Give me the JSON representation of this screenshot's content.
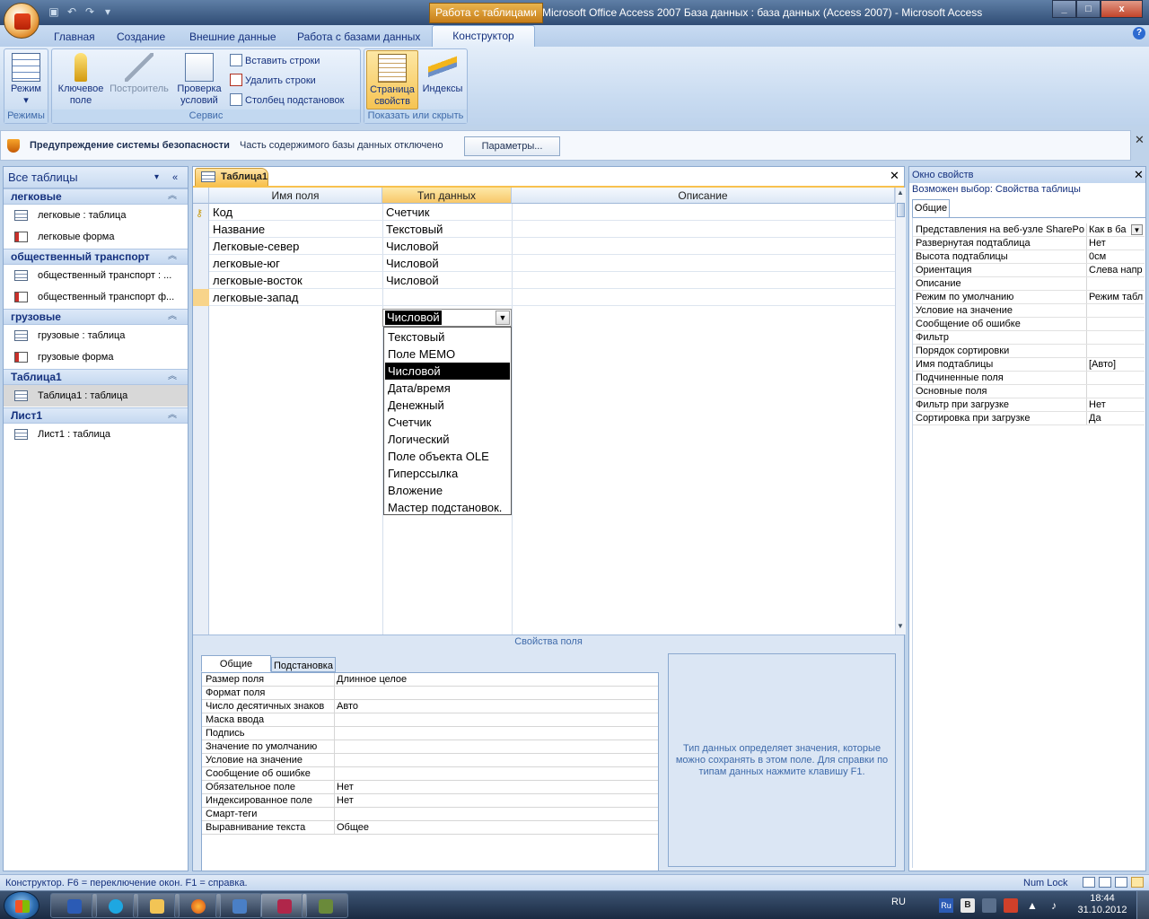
{
  "window": {
    "context_title": "Работа с таблицами",
    "title": "Microsoft Office Access 2007 База данных : база данных (Access 2007) - Microsoft Access",
    "controls": [
      "_",
      "□",
      "x"
    ]
  },
  "qat": {
    "icons": [
      "save-icon",
      "undo-icon",
      "redo-icon",
      "customize-icon"
    ]
  },
  "ribbon": {
    "tabs": [
      "Главная",
      "Создание",
      "Внешние данные",
      "Работа с базами данных",
      "Конструктор"
    ],
    "active_tab": "Конструктор",
    "groups": {
      "views": {
        "label": "Режимы",
        "mode_line1": "Режим",
        "mode_line2": "▾"
      },
      "tools": {
        "label": "Сервис",
        "key_line1": "Ключевое",
        "key_line2": "поле",
        "builder": "Построитель",
        "validate_line1": "Проверка",
        "validate_line2": "условий",
        "insert_rows": "Вставить строки",
        "delete_rows": "Удалить строки",
        "lookup_column": "Столбец  подстановок"
      },
      "show_hide": {
        "label": "Показать или скрыть",
        "props_line1": "Страница",
        "props_line2": "свойств",
        "indexes": "Индексы"
      }
    }
  },
  "security_bar": {
    "title": "Предупреждение системы безопасности",
    "message": "Часть содержимого базы данных отключено",
    "button": "Параметры..."
  },
  "nav": {
    "header": "Все таблицы",
    "groups": [
      {
        "label": "легковые",
        "items": [
          "легковые : таблица",
          "легковые форма"
        ]
      },
      {
        "label": "общественный транспорт",
        "items": [
          "общественный транспорт : ...",
          "общественный транспорт ф..."
        ]
      },
      {
        "label": "грузовые",
        "items": [
          "грузовые : таблица",
          "грузовые форма"
        ]
      },
      {
        "label": "Таблица1",
        "items": [
          "Таблица1 : таблица"
        ]
      },
      {
        "label": "Лист1",
        "items": [
          "Лист1 : таблица"
        ]
      }
    ]
  },
  "document": {
    "tab": "Таблица1",
    "columns": [
      "Имя поля",
      "Тип данных",
      "Описание"
    ],
    "rows": [
      {
        "name": "Код",
        "type": "Счетчик",
        "desc": "",
        "key": true
      },
      {
        "name": "Название",
        "type": "Текстовый",
        "desc": ""
      },
      {
        "name": "Легковые-север",
        "type": "Числовой",
        "desc": ""
      },
      {
        "name": "легковые-юг",
        "type": "Числовой",
        "desc": ""
      },
      {
        "name": "легковые-восток",
        "type": "Числовой",
        "desc": ""
      },
      {
        "name": "легковые-запад",
        "type": "Числовой",
        "desc": ""
      }
    ],
    "dropdown": {
      "current": "Числовой",
      "options": [
        "Текстовый",
        "Поле MEMO",
        "Числовой",
        "Дата/время",
        "Денежный",
        "Счетчик",
        "Логический",
        "Поле объекта OLE",
        "Гиперссылка",
        "Вложение",
        "Мастер подстановок."
      ],
      "highlighted": "Числовой"
    },
    "field_props": {
      "title": "Свойства поля",
      "tabs": [
        "Общие",
        "Подстановка"
      ],
      "rows": [
        {
          "key": "Размер поля",
          "value": "Длинное целое"
        },
        {
          "key": "Формат поля",
          "value": ""
        },
        {
          "key": "Число десятичных знаков",
          "value": "Авто"
        },
        {
          "key": "Маска ввода",
          "value": ""
        },
        {
          "key": "Подпись",
          "value": ""
        },
        {
          "key": "Значение по умолчанию",
          "value": ""
        },
        {
          "key": "Условие на значение",
          "value": ""
        },
        {
          "key": "Сообщение об ошибке",
          "value": ""
        },
        {
          "key": "Обязательное поле",
          "value": "Нет"
        },
        {
          "key": "Индексированное поле",
          "value": "Нет"
        },
        {
          "key": "Смарт-теги",
          "value": ""
        },
        {
          "key": "Выравнивание текста",
          "value": "Общее"
        }
      ],
      "help": "Тип данных определяет значения, которые можно сохранять в этом поле.  Для справки по типам данных нажмите клавишу F1."
    }
  },
  "property_sheet": {
    "title": "Окно свойств",
    "selection": "Возможен выбор:  Свойства таблицы",
    "tab": "Общие",
    "rows": [
      {
        "key": "Представления на веб-узле SharePo",
        "value": "Как в ба"
      },
      {
        "key": "Развернутая подтаблица",
        "value": "Нет"
      },
      {
        "key": "Высота подтаблицы",
        "value": "0см"
      },
      {
        "key": "Ориентация",
        "value": "Слева напр"
      },
      {
        "key": "Описание",
        "value": ""
      },
      {
        "key": "Режим по умолчанию",
        "value": "Режим табл"
      },
      {
        "key": "Условие на значение",
        "value": ""
      },
      {
        "key": "Сообщение об ошибке",
        "value": ""
      },
      {
        "key": "Фильтр",
        "value": ""
      },
      {
        "key": "Порядок сортировки",
        "value": ""
      },
      {
        "key": "Имя подтаблицы",
        "value": "[Авто]"
      },
      {
        "key": "Подчиненные поля",
        "value": ""
      },
      {
        "key": "Основные поля",
        "value": ""
      },
      {
        "key": "Фильтр при загрузке",
        "value": "Нет"
      },
      {
        "key": "Сортировка при загрузке",
        "value": "Да"
      }
    ]
  },
  "statusbar": {
    "text": "Конструктор.  F6 = переключение окон.  F1 = справка.",
    "numlock": "Num Lock"
  },
  "taskbar": {
    "lang": "RU",
    "time": "18:44",
    "date": "31.10.2012"
  }
}
